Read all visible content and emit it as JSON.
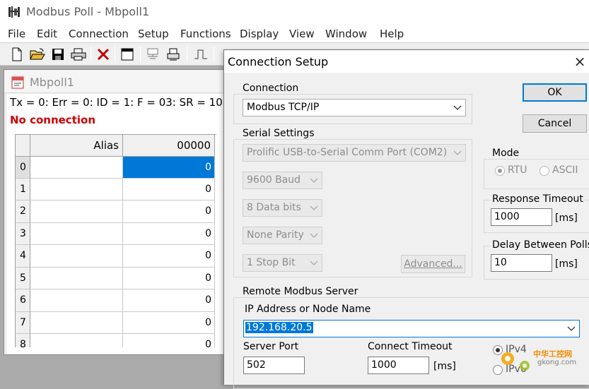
{
  "window": {
    "title": "Modbus Poll - Mbpoll1"
  },
  "menu": [
    "File",
    "Edit",
    "Connection",
    "Setup",
    "Functions",
    "Display",
    "View",
    "Window",
    "Help"
  ],
  "toolbar": {
    "icons": [
      "new-file-icon",
      "open-folder-icon",
      "save-icon",
      "print-icon",
      "delete-icon",
      "window-icon",
      "communication-icon",
      "printer-tray-icon",
      "pulse-icon"
    ]
  },
  "child": {
    "title": "Mbpoll1",
    "status": "Tx = 0: Err = 0: ID = 1: F = 03: SR = 10",
    "no_connection": "No connection",
    "columns": [
      "Alias",
      "00000"
    ],
    "rows": [
      {
        "index": "0",
        "alias": "",
        "value": "0"
      },
      {
        "index": "1",
        "alias": "",
        "value": "0"
      },
      {
        "index": "2",
        "alias": "",
        "value": "0"
      },
      {
        "index": "3",
        "alias": "",
        "value": "0"
      },
      {
        "index": "4",
        "alias": "",
        "value": "0"
      },
      {
        "index": "5",
        "alias": "",
        "value": "0"
      },
      {
        "index": "6",
        "alias": "",
        "value": "0"
      },
      {
        "index": "7",
        "alias": "",
        "value": "0"
      },
      {
        "index": "8",
        "alias": "",
        "value": "0"
      }
    ]
  },
  "dialog": {
    "title": "Connection Setup",
    "close": "×",
    "connection_group": "Connection",
    "connection_value": "Modbus TCP/IP",
    "serial_group": "Serial Settings",
    "serial_port": "Prolific USB-to-Serial Comm Port (COM2)",
    "baud": "9600 Baud",
    "data_bits": "8 Data bits",
    "parity": "None Parity",
    "stop_bits": "1 Stop Bit",
    "advanced": "Advanced...",
    "ok": "OK",
    "cancel": "Cancel",
    "mode_group": "Mode",
    "mode_rtu": "RTU",
    "mode_ascii": "ASCII",
    "response_timeout_label": "Response Timeout",
    "response_timeout_value": "1000",
    "response_timeout_unit": "[ms]",
    "delay_label": "Delay Between Polls",
    "delay_value": "10",
    "delay_unit": "[ms]",
    "remote_group": "Remote Modbus Server",
    "ip_label": "IP Address or Node Name",
    "ip_value": "192.168.20.5",
    "server_port_label": "Server Port",
    "server_port_value": "502",
    "connect_timeout_label": "Connect Timeout",
    "connect_timeout_value": "1000",
    "connect_timeout_unit": "[ms]",
    "ipv4": "IPv4",
    "ipv6": "IPv6"
  },
  "watermark": {
    "line1": "中华工控网",
    "line2": "gkong.com"
  }
}
